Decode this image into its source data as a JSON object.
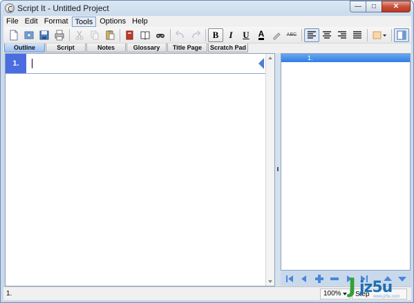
{
  "window": {
    "title": "Script It - Untitled Project",
    "controls": {
      "minimize": "—",
      "maximize": "□",
      "close": "✕"
    }
  },
  "menu": {
    "items": [
      "File",
      "Edit",
      "Format",
      "Tools",
      "Options",
      "Help"
    ],
    "active": "Tools"
  },
  "toolbar": {
    "buttons": [
      "new-document-icon",
      "open-icon",
      "save-icon",
      "print-icon",
      "cut-icon",
      "copy-icon",
      "paste-icon",
      "spellcheck-icon",
      "book-icon",
      "find-icon",
      "undo-icon",
      "redo-icon",
      "bold-icon",
      "italic-icon",
      "underline-icon",
      "font-color-icon",
      "highlight-icon",
      "strikethrough-icon",
      "align-left-icon",
      "align-center-icon",
      "align-right-icon",
      "justify-icon",
      "background-color-icon",
      "panel-toggle-icon"
    ],
    "bold_label": "B",
    "italic_label": "I",
    "underline_label": "U",
    "fontcolor_label": "A",
    "strike_label": "ABC"
  },
  "tabs": [
    {
      "label": "Outline",
      "active": true
    },
    {
      "label": "Script",
      "active": false
    },
    {
      "label": "Notes",
      "active": false
    },
    {
      "label": "Glossary",
      "active": false
    },
    {
      "label": "Title Page",
      "active": false
    },
    {
      "label": "Scratch Pad",
      "active": false
    }
  ],
  "outline": {
    "rows": [
      {
        "number": "1.",
        "text": ""
      }
    ]
  },
  "right_panel": {
    "header": "1."
  },
  "nav_buttons": [
    "first-icon",
    "previous-icon",
    "add-icon",
    "remove-icon",
    "next-icon",
    "last-icon",
    "move-up-icon",
    "move-down-icon"
  ],
  "status": {
    "left": "1.",
    "zoom": "100%",
    "step": "Step"
  },
  "watermark": {
    "j": "J",
    "text": "jz5u",
    "sub": "www.jz5u.com"
  },
  "colors": {
    "accent": "#4a6de0",
    "header_blue": "#2e7ee6",
    "tab_active": "#9ec0ee"
  }
}
